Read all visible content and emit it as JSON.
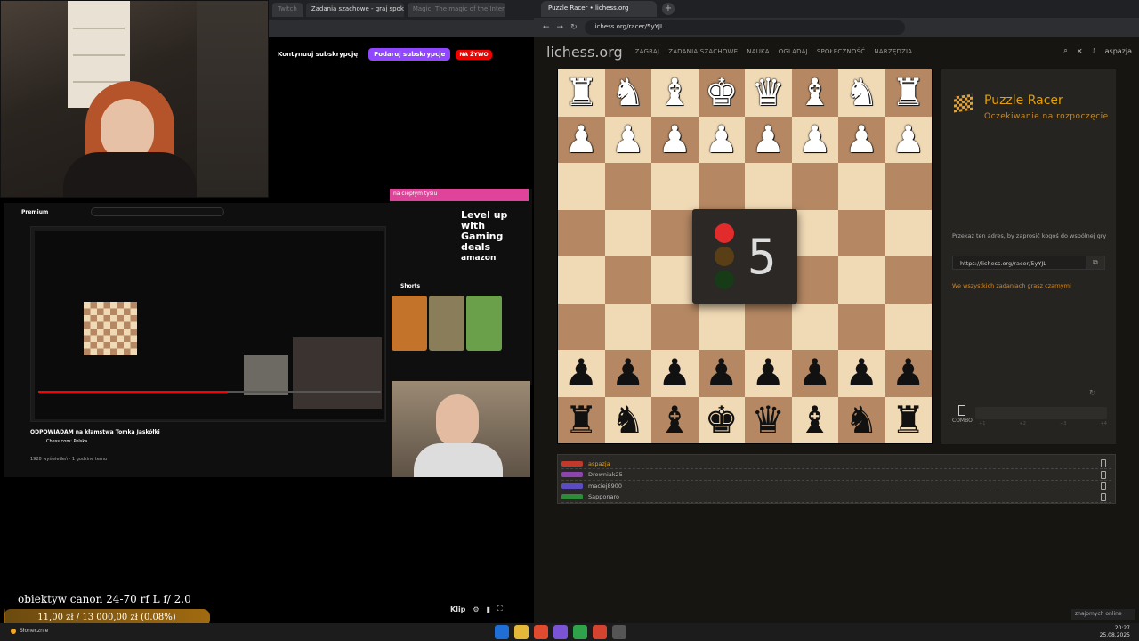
{
  "left_stream": {
    "twitch_tabs": [
      "Twitch",
      "Zadania szachowe - graj spokojnie",
      "Magic: The magic of the Interne"
    ],
    "subscribe_continue": "Kontynuuj subskrypcję",
    "gift_subscription": "Podaruj subskrypcje",
    "live_badge": "NA ŻYWO",
    "youtube": {
      "logo": "Premium",
      "video_title": "ODPOWIADAM na kłamstwa Tomka Jaskółki",
      "channel": "Chess.com: Polska",
      "views": "1928 wyświetleń · 1 godzinę temu",
      "progress_fraction": 0.55
    },
    "ad_banner": "na ciepłym tysiu",
    "ad_text": "Level up with Gaming deals",
    "ad_brand": "amazon",
    "shorts_label": "Shorts",
    "shorts_colors": [
      "#c4742a",
      "#8a7d5a",
      "#6aa04a"
    ],
    "cam_text": "obiektyw canon 24-70 rf L f/ 2.0",
    "sub_goal": "11,00 zł / 13 000,00 zł (0.08%)",
    "sub_goal_fraction": 0.0008,
    "clip_label": "Klip"
  },
  "browser": {
    "tab_title": "Puzzle Racer • lichess.org",
    "url": "lichess.org/racer/5yYJL"
  },
  "lichess": {
    "logo": "lichess.org",
    "nav": [
      "ZAGRAJ",
      "ZADANIA SZACHOWE",
      "NAUKA",
      "OGLĄDAJ",
      "SPOŁECZNOŚĆ",
      "NARZĘDZIA"
    ],
    "username": "aspazja",
    "countdown_number": "5",
    "countdown_colors": {
      "red": "#e22b2b",
      "amber": "#5a3f16",
      "green": "#173a17"
    },
    "board_light": "#f0d9b5",
    "board_dark": "#b58863",
    "racer": {
      "title": "Puzzle Racer",
      "subtitle": "Oczekiwanie na rozpoczęcie",
      "invite_text": "Przekaż ten adres, by zaprosić kogoś do wspólnej gry",
      "invite_url": "https://lichess.org/racer/5yYJL",
      "color_note": "We wszystkich zadaniach grasz czarnymi",
      "combo_label": "COMBO",
      "combo_ticks": [
        "+1",
        "+2",
        "+3",
        "+4"
      ]
    },
    "racers": [
      {
        "name": "aspazja",
        "car_color": "#c0392b",
        "me": true
      },
      {
        "name": "Drewniak25",
        "car_color": "#8e44ad",
        "me": false
      },
      {
        "name": "maciej8900",
        "car_color": "#5b4cc4",
        "me": false
      },
      {
        "name": "Sapponaro",
        "car_color": "#2e8b3a",
        "me": false
      }
    ]
  },
  "taskbar": {
    "weather": "Słonecznie",
    "online_tag": "znajomych online",
    "time": "20:27",
    "date": "25.08.2025"
  }
}
